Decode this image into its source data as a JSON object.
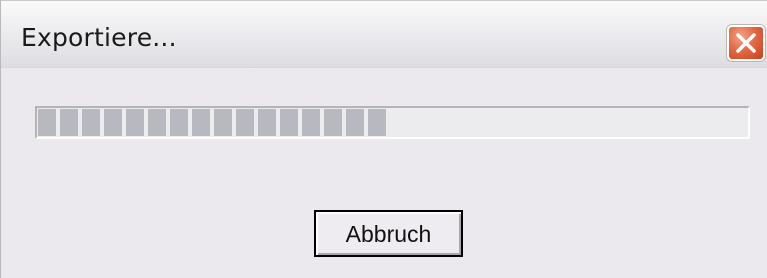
{
  "window": {
    "title": "Exportiere..."
  },
  "progress": {
    "fraction": 0.5,
    "chunks_filled": 16
  },
  "buttons": {
    "abort_label": "Abbruch"
  },
  "icons": {
    "close": "close-icon"
  },
  "colors": {
    "close_button": "#d9532e",
    "progress_chunk": "#b8b8c0",
    "dialog_background": "#ebe9ed"
  }
}
